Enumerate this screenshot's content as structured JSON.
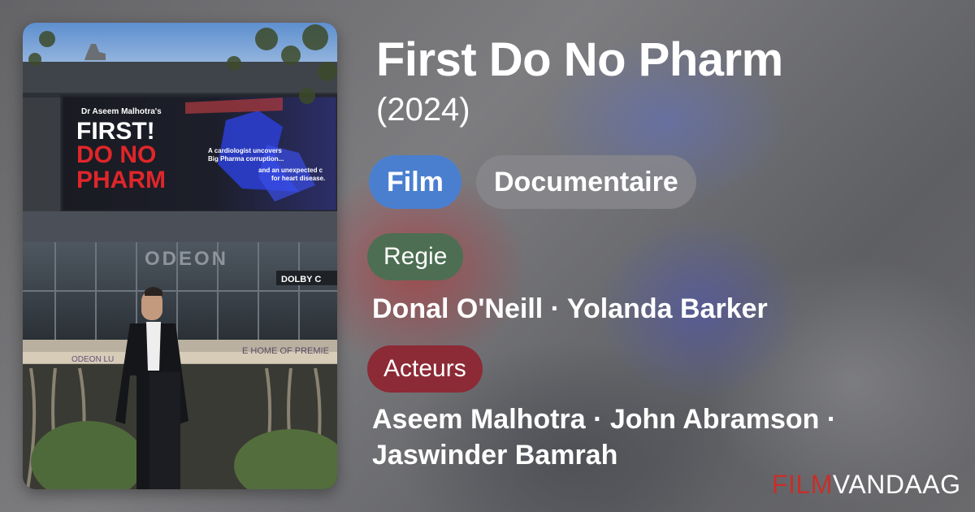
{
  "movie": {
    "title": "First Do No Pharm",
    "year": "(2024)",
    "poster": {
      "billboard_credit": "Dr Aseem Malhotra's",
      "billboard_title_1": "FIRST!",
      "billboard_title_2": "DO NO",
      "billboard_title_3": "PHARM",
      "billboard_tagline_1": "A cardiologist uncovers",
      "billboard_tagline_2": "Big Pharma corruption...",
      "billboard_tagline_3": "and an unexpected c",
      "billboard_tagline_4": "for heart disease.",
      "cinema_sign": "ODEON",
      "dolby_sign": "DOLBY C",
      "banner_left": "ODEON LU",
      "banner_right": "E HOME OF PREMIE"
    }
  },
  "tags": {
    "type": "Film",
    "genre": "Documentaire"
  },
  "directing": {
    "label": "Regie",
    "names": "Donal O'Neill · Yolanda Barker"
  },
  "cast": {
    "label": "Acteurs",
    "names_line1": "Aseem Malhotra · John Abramson ·",
    "names_line2": "Jaswinder Bamrah"
  },
  "brand": {
    "part1": "FILM",
    "part2": "VANDAAG"
  },
  "colors": {
    "film_chip": "#4a7fd0",
    "genre_chip": "#87878c",
    "regie_label": "#4d6e52",
    "acteurs_label": "#8c2a36",
    "brand_red": "#c5302a"
  }
}
